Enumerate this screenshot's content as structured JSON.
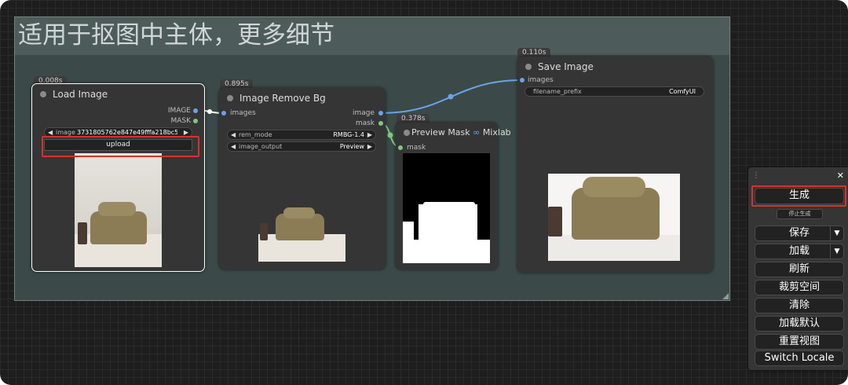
{
  "group": {
    "title": "适用于抠图中主体，更多细节"
  },
  "nodes": {
    "load_image": {
      "time": "0.008s",
      "title": "Load Image",
      "outputs": [
        "IMAGE",
        "MASK"
      ],
      "image_widget": {
        "label": "image",
        "value": "3731805762e847e49fffa218bc56..."
      },
      "upload_label": "upload"
    },
    "remove_bg": {
      "time": "0.895s",
      "title": "Image Remove Bg",
      "input": "images",
      "outputs": [
        "image",
        "mask"
      ],
      "widgets": [
        {
          "label": "rem_mode",
          "value": "RMBG-1.4"
        },
        {
          "label": "image_output",
          "value": "Preview"
        }
      ]
    },
    "preview_mask": {
      "time": "0.378s",
      "title": "Preview Mask",
      "badge_symbol": "∞",
      "badge": "Mixlab",
      "input": "mask"
    },
    "save_image": {
      "time": "0.110s",
      "title": "Save Image",
      "input": "images",
      "widget": {
        "label": "filename_prefix",
        "value": "ComfyUI"
      }
    }
  },
  "menu": {
    "handle": "⋮",
    "close": "✕",
    "generate": "生成",
    "stop": "停止生成",
    "save": "保存",
    "load": "加载",
    "refresh": "刷新",
    "clipspace": "裁剪空间",
    "clear": "清除",
    "load_default": "加载默认",
    "reset_view": "重置视图",
    "switch_locale": "Switch Locale",
    "dropdown_symbol": "▼"
  },
  "colors": {
    "group_bg": "#3b4a48",
    "group_title_bg": "#4d5c5a",
    "node_bg": "#353535",
    "highlight": "#d9302c",
    "image_link": "#6aa3e8",
    "mask_link": "#7ec87e"
  },
  "icons": {
    "left_arrow": "◀",
    "right_arrow": "▶"
  }
}
